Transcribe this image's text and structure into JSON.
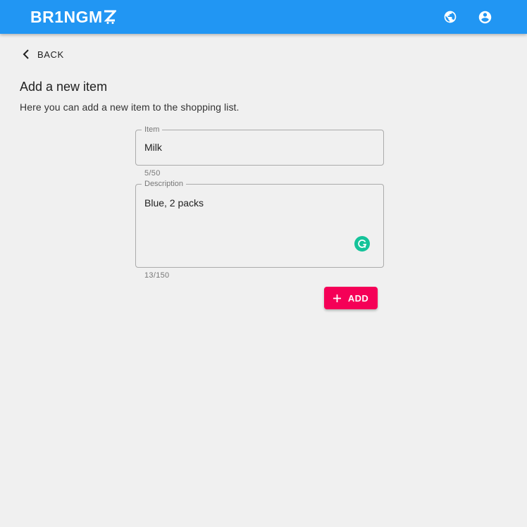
{
  "app": {
    "logo_text": "BR1NGM",
    "logo_icon": "cart-z-icon",
    "icons": {
      "language": "globe-icon",
      "account": "account-circle-icon"
    },
    "colors": {
      "appbar": "#2196f3",
      "accent": "#f50057",
      "grammarly": "#15c39a",
      "background": "#f0f0f0"
    }
  },
  "nav": {
    "back_label": "BACK",
    "back_icon": "chevron-left-icon"
  },
  "page": {
    "title": "Add a new item",
    "description": "Here you can add a new item to the shopping list."
  },
  "form": {
    "item": {
      "label": "Item",
      "value": "Milk",
      "counter": "5/50"
    },
    "description": {
      "label": "Description",
      "value": "Blue, 2 packs",
      "counter": "13/150",
      "assist_icon": "grammarly-icon"
    },
    "add_button": {
      "label": "ADD",
      "icon": "plus-icon"
    }
  }
}
